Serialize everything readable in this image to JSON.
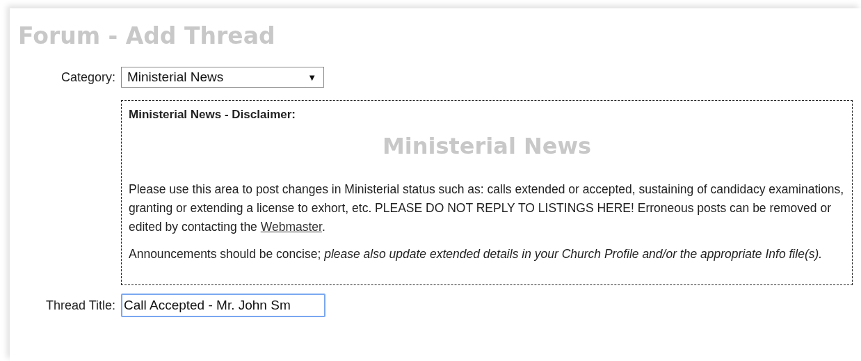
{
  "page_title": "Forum - Add Thread",
  "category": {
    "label": "Category:",
    "value": "Ministerial News",
    "caret": "▼"
  },
  "disclaimer": {
    "heading": "Ministerial News - Disclaimer:",
    "title": "Ministerial News",
    "paragraph_1": {
      "before": "Please use this area to post changes in Ministerial status such as: calls extended or accepted, sustaining of candidacy examinations, granting or extending a license to exhort, etc. PLEASE DO NOT REPLY TO LISTINGS HERE! Erroneous posts can be removed or edited by contacting the",
      "link": "Webmaster",
      "after": "."
    },
    "paragraph_2": "Announcements should be concise; *please also update extended details in your Church Profile and/or the appropriate Info file(s).*"
  },
  "thread_title": {
    "label": "Thread Title:",
    "value": "Call Accepted - Mr. John Sm",
    "focused": true
  }
}
